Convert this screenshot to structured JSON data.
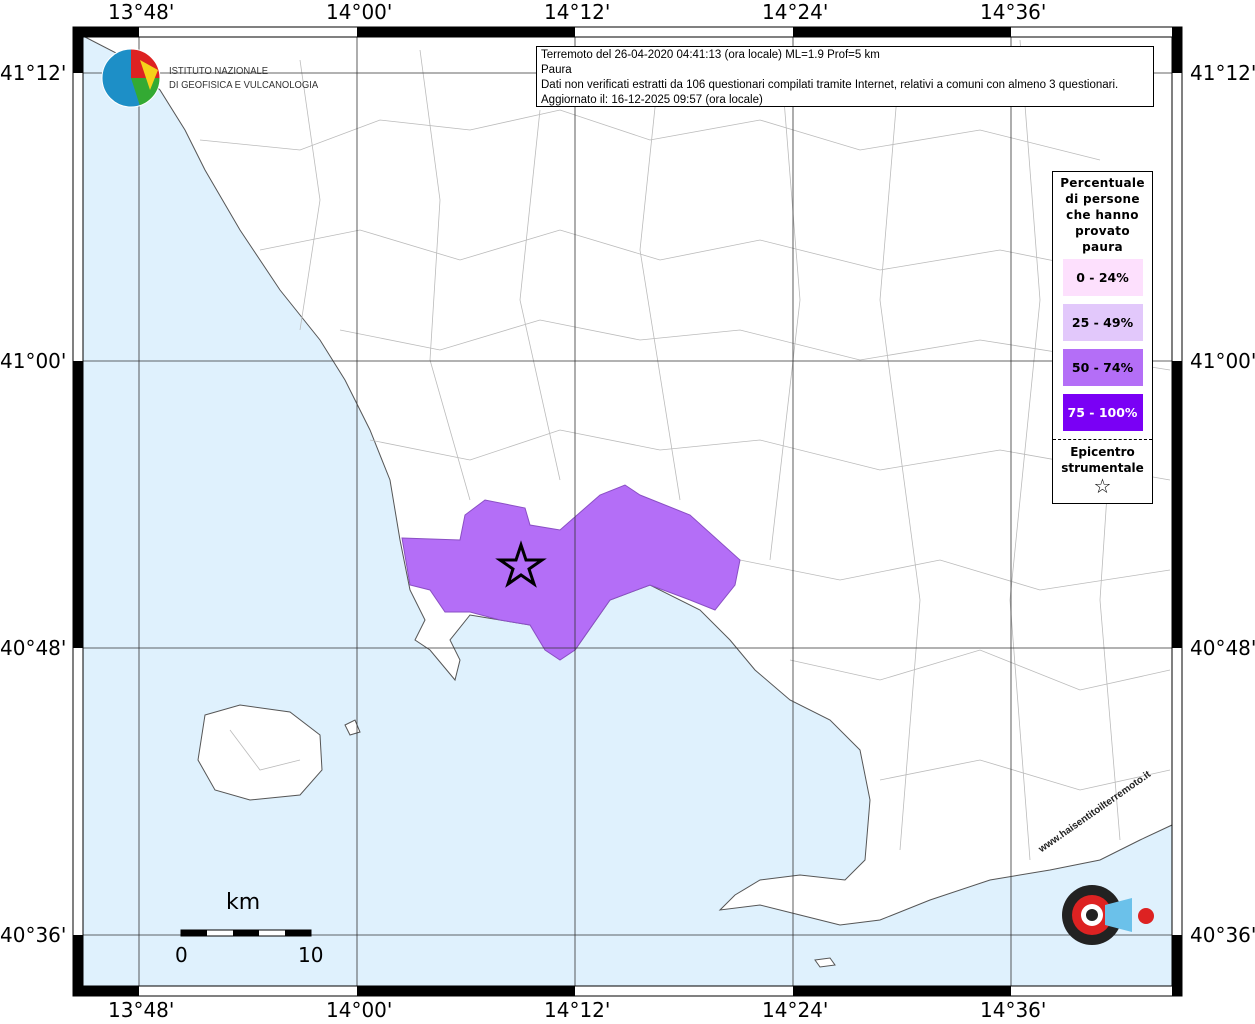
{
  "info": {
    "line1": "Terremoto del 26-04-2020 04:41:13 (ora locale) ML=1.9 Prof=5 km",
    "line2": "Paura",
    "line3": "Dati non verificati estratti da 106 questionari compilati tramite Internet, relativi a comuni con almeno 3 questionari.",
    "line4": "Aggiornato il: 16-12-2025 09:57 (ora locale)"
  },
  "logo_ingv": {
    "line1": "ISTITUTO NAZIONALE",
    "line2": "DI GEOFISICA E VULCANOLOGIA"
  },
  "logo_hsit": "www.haisentitoilterremoto.it",
  "axes": {
    "lon_ticks": [
      "13°48'",
      "14°00'",
      "14°12'",
      "14°24'",
      "14°36'"
    ],
    "lat_ticks": [
      "41°12'",
      "41°00'",
      "40°48'",
      "40°36'"
    ]
  },
  "legend": {
    "title": [
      "Percentuale",
      "di persone",
      "che hanno",
      "provato",
      "paura"
    ],
    "items": [
      {
        "label": "0 - 24%",
        "color": "#fde0fd",
        "text_color": "#000000"
      },
      {
        "label": "25 - 49%",
        "color": "#e2c8fb",
        "text_color": "#000000"
      },
      {
        "label": "50 - 74%",
        "color": "#b46ef7",
        "text_color": "#000000"
      },
      {
        "label": "75 - 100%",
        "color": "#7a00f5",
        "text_color": "#ffffff"
      }
    ],
    "epicenter_label": [
      "Epicentro",
      "strumentale"
    ],
    "epicenter_icon": "star-outline-icon"
  },
  "scale": {
    "unit": "km",
    "start": "0",
    "end": "10"
  },
  "colors": {
    "sea": "#dff1fd",
    "land": "#ffffff",
    "affected_area": "#b46ef7"
  },
  "affected_area_class": "50 - 74%"
}
